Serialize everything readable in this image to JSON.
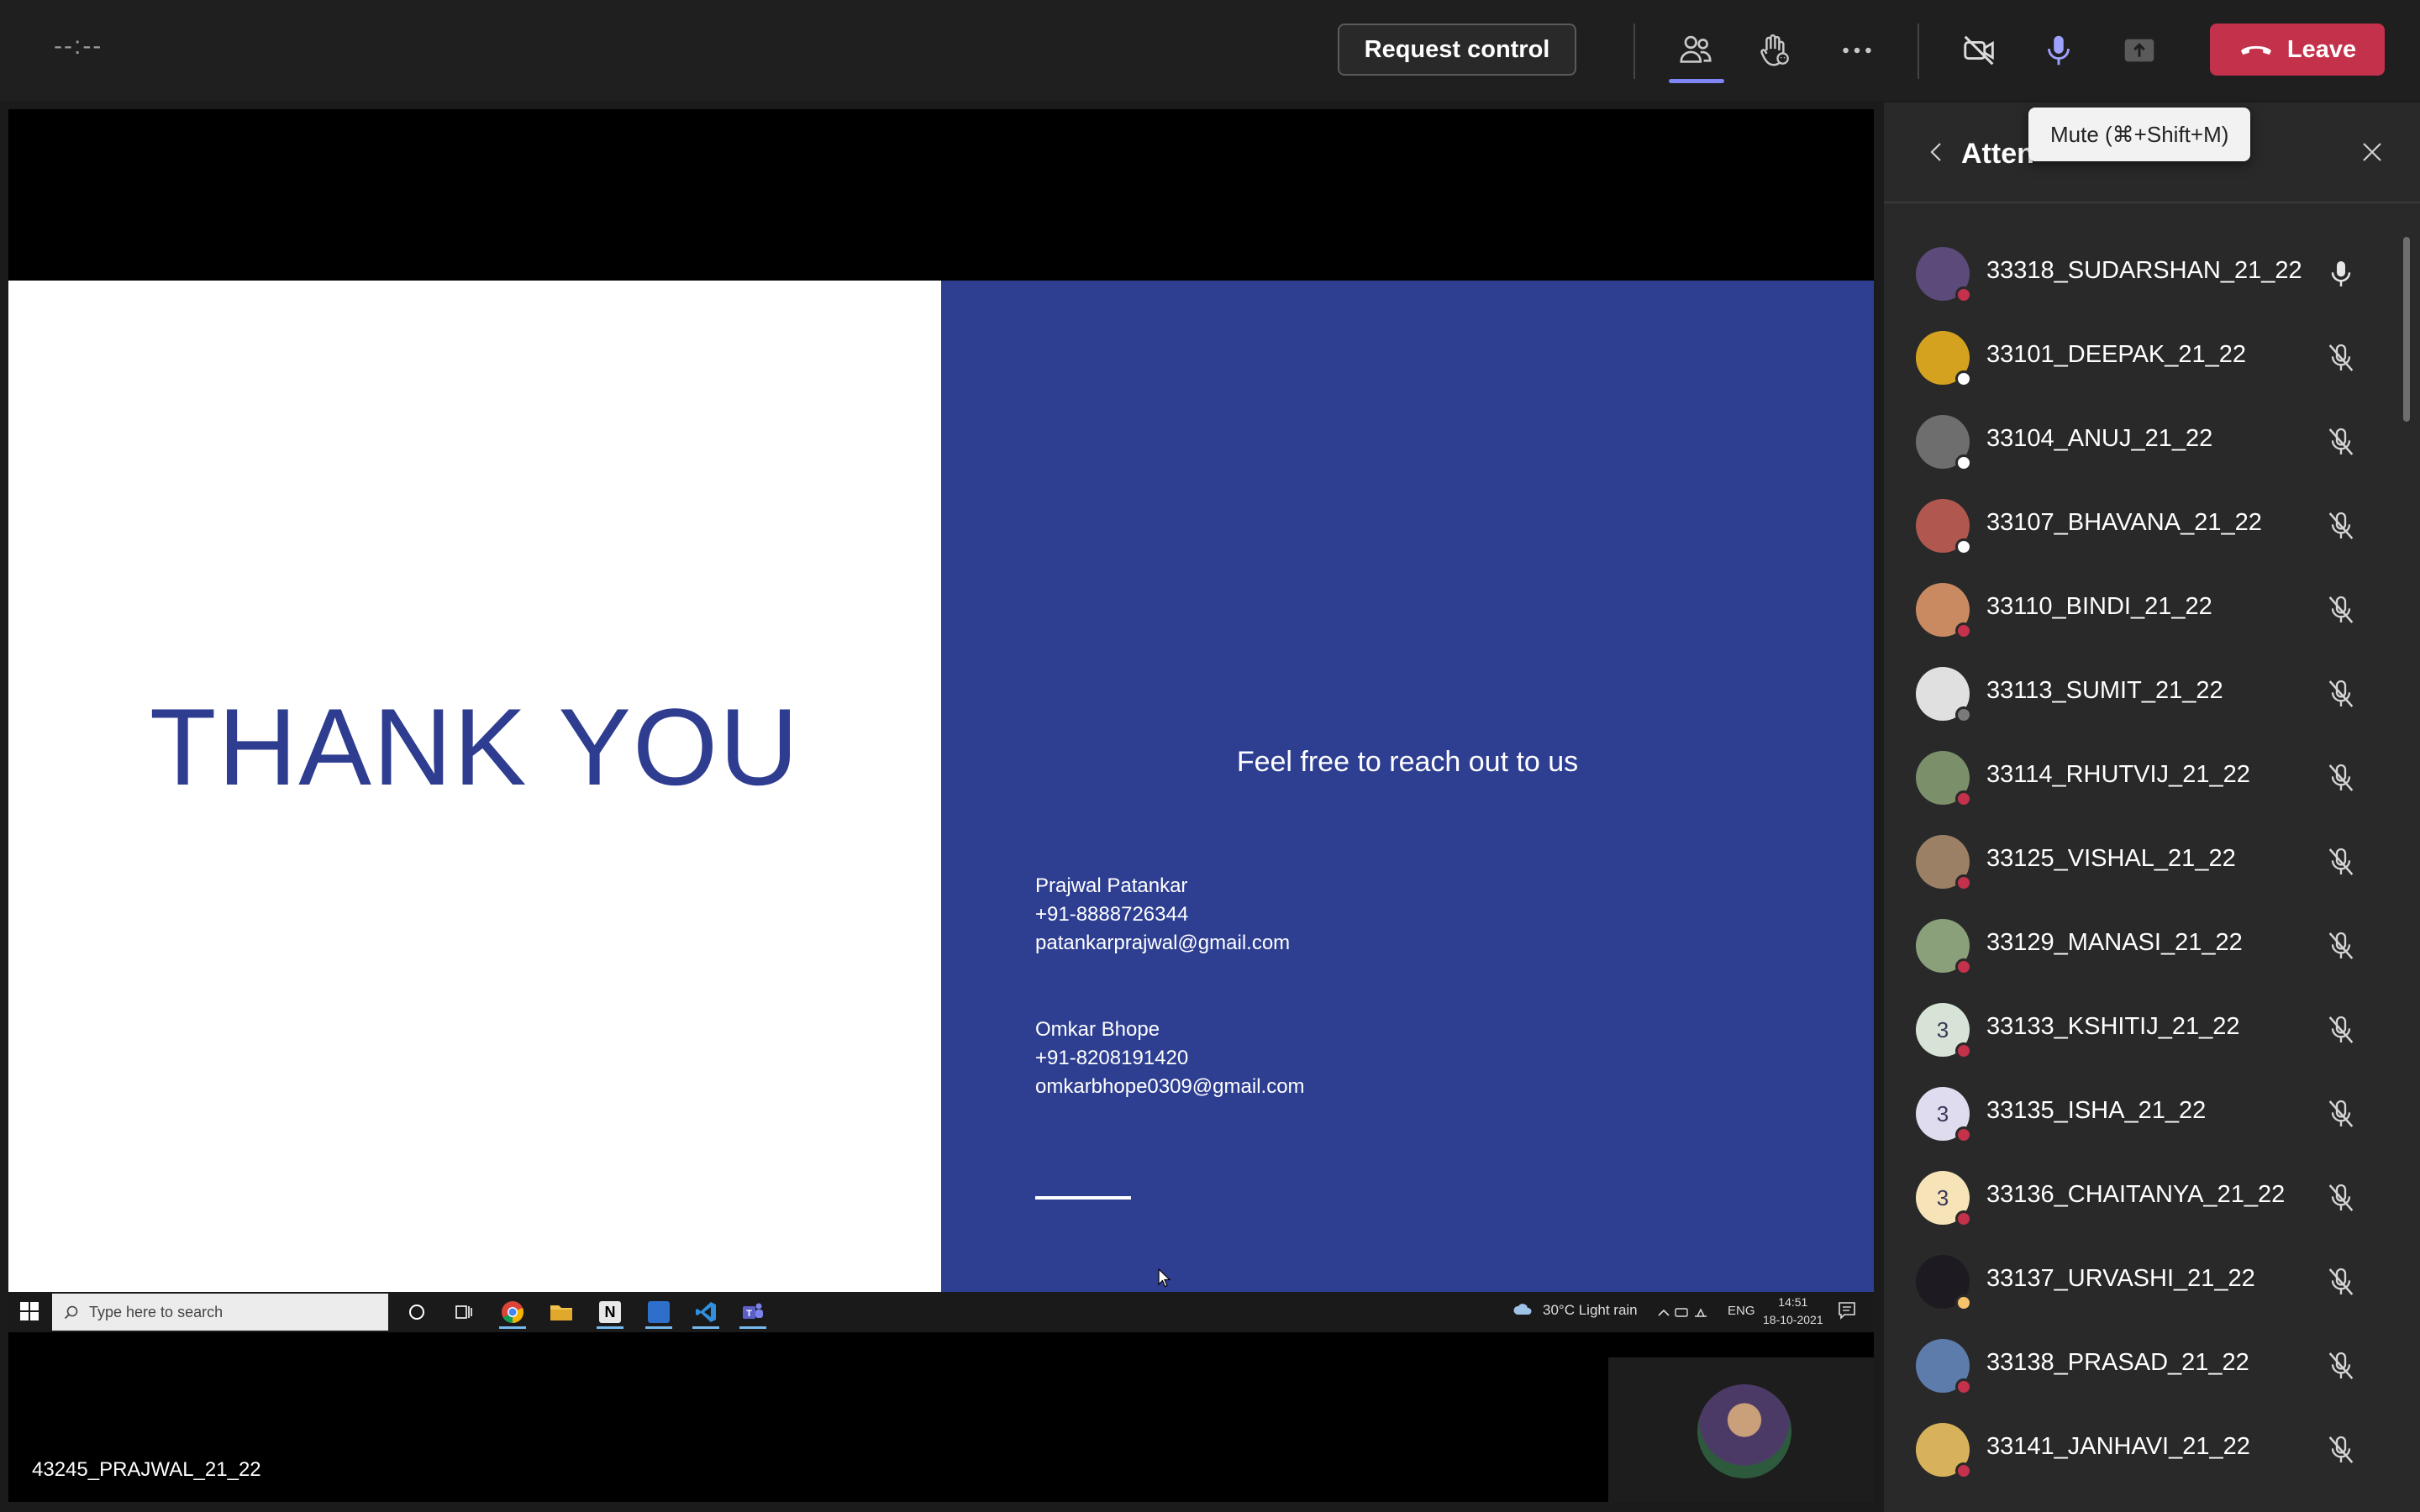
{
  "topbar": {
    "timer": "--:--",
    "request_control_label": "Request control",
    "leave_label": "Leave",
    "colors": {
      "leave": "#c4314b",
      "accent": "#7f85f5"
    }
  },
  "tooltip": {
    "text": "Mute (⌘+Shift+M)"
  },
  "slide": {
    "title": "THANK YOU",
    "reach_out": "Feel free to reach out to us",
    "contacts": [
      {
        "name": "Prajwal Patankar",
        "phone": "+91-8888726344",
        "email": "patankarprajwal@gmail.com"
      },
      {
        "name": "Omkar Bhope",
        "phone": "+91-8208191420",
        "email": "omkarbhope0309@gmail.com"
      }
    ],
    "colors": {
      "title": "#2e3d8f",
      "right_bg": "#2e3f92"
    }
  },
  "win_taskbar": {
    "search_placeholder": "Type here to search",
    "weather": "30°C  Light rain",
    "lang": "ENG",
    "time": "14:51",
    "date": "18-10-2021"
  },
  "presenter": {
    "name": "43245_PRAJWAL_21_22"
  },
  "panel": {
    "title": "Atten",
    "attendees": [
      {
        "name": "33318_SUDARSHAN_21_22",
        "mic": "on",
        "status": "busy",
        "initial": ""
      },
      {
        "name": "33101_DEEPAK_21_22",
        "mic": "muted",
        "status": "away",
        "initial": ""
      },
      {
        "name": "33104_ANUJ_21_22",
        "mic": "muted",
        "status": "away",
        "initial": ""
      },
      {
        "name": "33107_BHAVANA_21_22",
        "mic": "muted",
        "status": "away",
        "initial": ""
      },
      {
        "name": "33110_BINDI_21_22",
        "mic": "muted",
        "status": "busy",
        "initial": ""
      },
      {
        "name": "33113_SUMIT_21_22",
        "mic": "muted",
        "status": "offline",
        "initial": ""
      },
      {
        "name": "33114_RHUTVIJ_21_22",
        "mic": "muted",
        "status": "busy",
        "initial": ""
      },
      {
        "name": "33125_VISHAL_21_22",
        "mic": "muted",
        "status": "busy",
        "initial": ""
      },
      {
        "name": "33129_MANASI_21_22",
        "mic": "muted",
        "status": "busy",
        "initial": ""
      },
      {
        "name": "33133_KSHITIJ_21_22",
        "mic": "muted",
        "status": "busy",
        "initial": "3"
      },
      {
        "name": "33135_ISHA_21_22",
        "mic": "muted",
        "status": "busy",
        "initial": "3"
      },
      {
        "name": "33136_CHAITANYA_21_22",
        "mic": "muted",
        "status": "busy",
        "initial": "3"
      },
      {
        "name": "33137_URVASHI_21_22",
        "mic": "muted",
        "status": "idle",
        "initial": ""
      },
      {
        "name": "33138_PRASAD_21_22",
        "mic": "muted",
        "status": "busy",
        "initial": ""
      },
      {
        "name": "33141_JANHAVI_21_22",
        "mic": "muted",
        "status": "busy",
        "initial": ""
      }
    ]
  }
}
